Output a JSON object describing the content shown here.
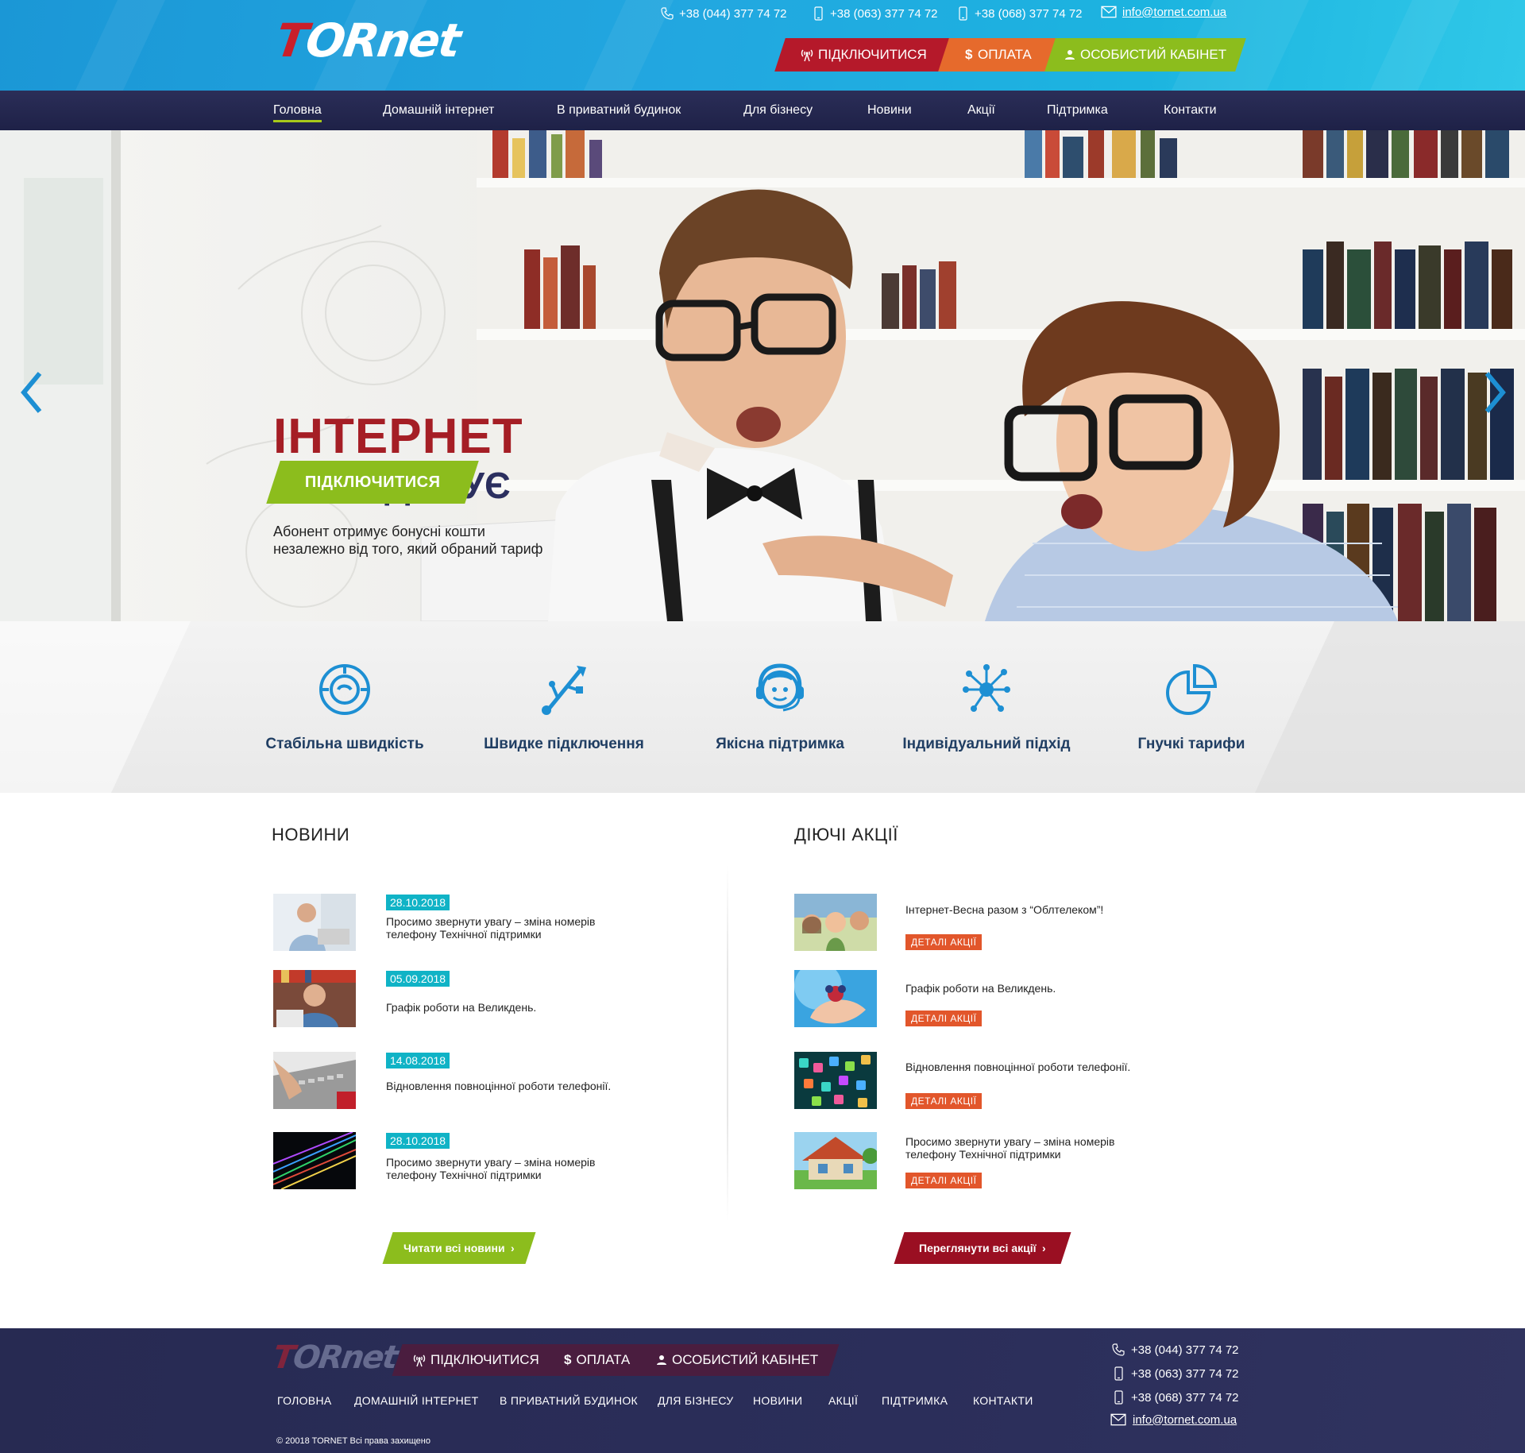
{
  "header": {
    "logo": {
      "t": "T",
      "rest": "ORnet"
    },
    "phones": [
      "+38 (044) 377 74 72",
      "+38 (063) 377 74 72",
      "+38 (068) 377 74 72"
    ],
    "email": "info@tornet.com.ua",
    "buttons": {
      "connect": "ПІДКЛЮЧИТИСЯ",
      "payment": "ОПЛАТА",
      "cabinet": "ОСОБИСТИЙ КАБІНЕТ"
    },
    "colors": {
      "connect": "#b5192a",
      "payment": "#e66a2c",
      "cabinet": "#8cbd1d"
    }
  },
  "nav": {
    "items": [
      "Головна",
      "Домашній інтернет",
      "В приватний будинок",
      "Для бізнесу",
      "Новини",
      "Акції",
      "Підтримка",
      "Контакти"
    ],
    "active": "Головна"
  },
  "hero": {
    "title": "ІНТЕРНЕТ",
    "subtitle": "ЯКИЙ ДИВУЄ",
    "text_line1": "Абонент отримує бонусні кошти",
    "text_line2": "незалежно від того, який обраний тариф",
    "button": "ПІДКЛЮЧИТИСЯ"
  },
  "features": [
    {
      "icon": "speedometer-icon",
      "label": "Стабільна швидкість"
    },
    {
      "icon": "usb-icon",
      "label": "Швидке  підключення"
    },
    {
      "icon": "headset-support-icon",
      "label": "Якісна підтримка"
    },
    {
      "icon": "network-nodes-icon",
      "label": "Індивідуальний підхід"
    },
    {
      "icon": "pie-chart-icon",
      "label": "Гнучкі тарифи"
    }
  ],
  "news": {
    "title": "НОВИНИ",
    "items": [
      {
        "date": "28.10.2018",
        "line1": "Просимо звернути увагу – зміна номерів",
        "line2": "телефону Технічної підтримки"
      },
      {
        "date": "05.09.2018",
        "line1": "Графік роботи на Великдень.",
        "line2": ""
      },
      {
        "date": "14.08.2018",
        "line1": "Відновлення повноцінної роботи телефонії.",
        "line2": ""
      },
      {
        "date": "28.10.2018",
        "line1": "Просимо звернути увагу – зміна номерів",
        "line2": "телефону Технічної підтримки"
      }
    ],
    "more": "Читати всі новини"
  },
  "promos": {
    "title": "ДІЮЧІ АКЦІЇ",
    "details_label": "ДЕТАЛІ АКЦІЇ",
    "items": [
      {
        "line1": "Інтернет-Весна разом з “Облтелеком”!",
        "line2": ""
      },
      {
        "line1": "Графік роботи на Великдень.",
        "line2": ""
      },
      {
        "line1": "Відновлення повноцінної роботи телефонії.",
        "line2": ""
      },
      {
        "line1": "Просимо звернути увагу – зміна номерів",
        "line2": "телефону Технічної підтримки"
      }
    ],
    "more": "Переглянути всі акції"
  },
  "footer": {
    "logo": {
      "t": "T",
      "rest": "ORnet"
    },
    "buttons": {
      "connect": "ПІДКЛЮЧИТИСЯ",
      "payment": "ОПЛАТА",
      "cabinet": "ОСОБИСТИЙ КАБІНЕТ"
    },
    "nav": [
      "ГОЛОВНА",
      "ДОМАШНІЙ ІНТЕРНЕТ",
      "В ПРИВАТНИЙ БУДИНОК",
      "ДЛЯ БІЗНЕСУ",
      "НОВИНИ",
      "АКЦІЇ",
      "ПІДТРИМКА",
      "КОНТАКТИ"
    ],
    "phones": [
      "+38 (044) 377 74 72",
      "+38 (063) 377 74 72",
      "+38 (068) 377 74 72"
    ],
    "email": "info@tornet.com.ua",
    "copyright": "© 20018 TORNET Всі права захищено"
  }
}
